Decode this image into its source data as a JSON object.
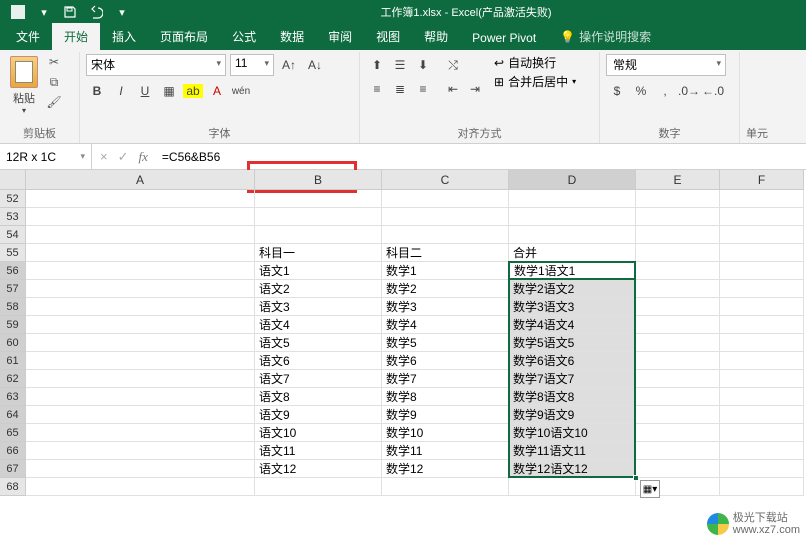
{
  "title": "工作簿1.xlsx  -  Excel(产品激活失败)",
  "tabs": {
    "file": "文件",
    "home": "开始",
    "insert": "插入",
    "layout": "页面布局",
    "formulas": "公式",
    "data": "数据",
    "review": "审阅",
    "view": "视图",
    "help": "帮助",
    "powerpivot": "Power Pivot",
    "tell_me": "操作说明搜索"
  },
  "ribbon": {
    "paste": "粘贴",
    "clipboard_label": "剪贴板",
    "font_name": "宋体",
    "font_size": "11",
    "font_label": "字体",
    "wrap_text": "自动换行",
    "merge_center": "合并后居中",
    "alignment_label": "对齐方式",
    "number_format": "常规",
    "number_label": "数字",
    "cells_label": "单元"
  },
  "namebox": "12R x 1C",
  "formula": "=C56&B56",
  "columns": [
    "A",
    "B",
    "C",
    "D",
    "E",
    "F"
  ],
  "rows": [
    "52",
    "53",
    "54",
    "55",
    "56",
    "57",
    "58",
    "59",
    "60",
    "61",
    "62",
    "63",
    "64",
    "65",
    "66",
    "67",
    "68"
  ],
  "headers": {
    "b": "科目一",
    "c": "科目二",
    "d": "合并"
  },
  "data_rows": [
    {
      "b": "语文1",
      "c": "数学1",
      "d": "数学1语文1"
    },
    {
      "b": "语文2",
      "c": "数学2",
      "d": "数学2语文2"
    },
    {
      "b": "语文3",
      "c": "数学3",
      "d": "数学3语文3"
    },
    {
      "b": "语文4",
      "c": "数学4",
      "d": "数学4语文4"
    },
    {
      "b": "语文5",
      "c": "数学5",
      "d": "数学5语文5"
    },
    {
      "b": "语文6",
      "c": "数学6",
      "d": "数学6语文6"
    },
    {
      "b": "语文7",
      "c": "数学7",
      "d": "数学7语文7"
    },
    {
      "b": "语文8",
      "c": "数学8",
      "d": "数学8语文8"
    },
    {
      "b": "语文9",
      "c": "数学9",
      "d": "数学9语文9"
    },
    {
      "b": "语文10",
      "c": "数学10",
      "d": "数学10语文10"
    },
    {
      "b": "语文11",
      "c": "数学11",
      "d": "数学11语文11"
    },
    {
      "b": "语文12",
      "c": "数学12",
      "d": "数学12语文12"
    }
  ],
  "watermark": {
    "line1": "极光下载站",
    "line2": "www.xz7.com"
  }
}
